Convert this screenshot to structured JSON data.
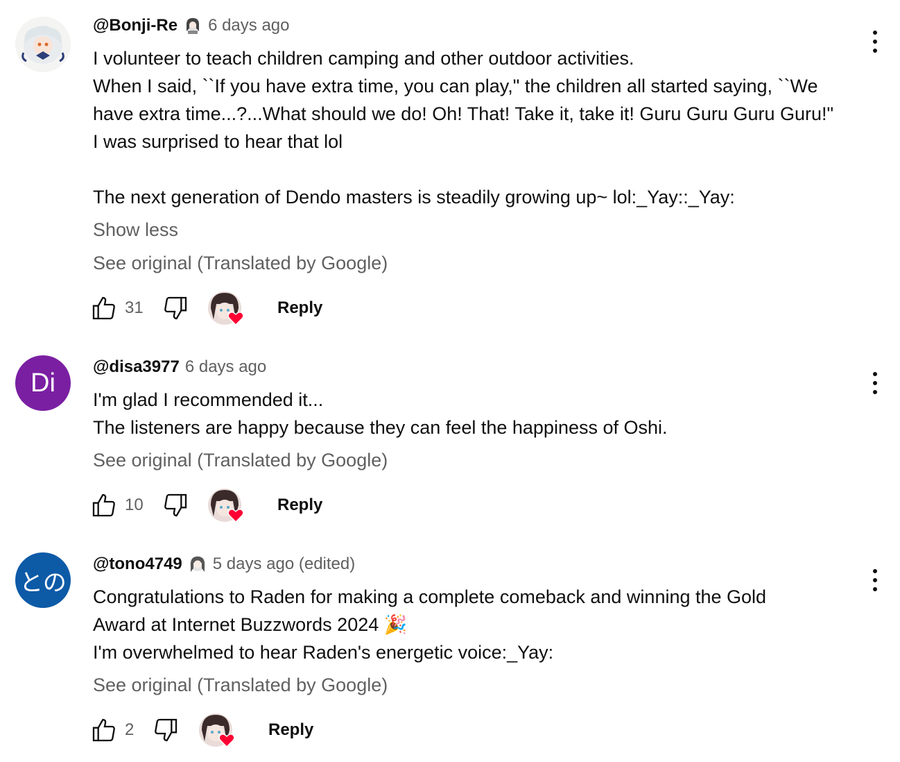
{
  "comments": [
    {
      "author": "@Bonji-Re",
      "time": "6 days ago",
      "badge_icon": "member-badge-icon",
      "avatar_icon": "anime-avatar-icon",
      "lines": [
        "I volunteer to teach children camping and other outdoor activities.",
        "When I said, ``If you have extra time, you can play,\" the children all started saying, ``We",
        "have extra time...?...What should we do! Oh! That! Take it, take it! Guru Guru Guru Guru!\"",
        "I was surprised to hear that lol",
        "",
        "The next generation of Dendo masters is steadily growing up~ lol:_Yay::_Yay:"
      ],
      "show_less": "Show less",
      "see_original": "See original (Translated by Google)",
      "likes": "31",
      "reply": "Reply"
    },
    {
      "author": "@disa3977",
      "time": "6 days ago",
      "avatar_letters": "Di",
      "avatar_color": "#7b1fa2",
      "lines": [
        "I'm glad I recommended it...",
        "The listeners are happy because they can feel the happiness of Oshi."
      ],
      "see_original": "See original (Translated by Google)",
      "likes": "10",
      "reply": "Reply"
    },
    {
      "author": "@tono4749",
      "time": "5 days ago (edited)",
      "badge_icon": "member-badge-icon",
      "avatar_letters": "との",
      "avatar_color": "#0d5aa7",
      "lines": [
        "Congratulations to Raden for making a complete comeback and winning the Gold",
        "Award at Internet Buzzwords 2024 🎉",
        "I'm overwhelmed to hear Raden's energetic voice:_Yay:"
      ],
      "see_original": "See original (Translated by Google)",
      "likes": "2",
      "reply": "Reply"
    }
  ],
  "colors": {
    "primary_text": "#0f0f0f",
    "secondary_text": "#606060",
    "heart": "#ff0033"
  },
  "icons": [
    "thumb-up-icon",
    "thumb-down-icon",
    "creator-heart-icon",
    "more-vert-icon"
  ]
}
